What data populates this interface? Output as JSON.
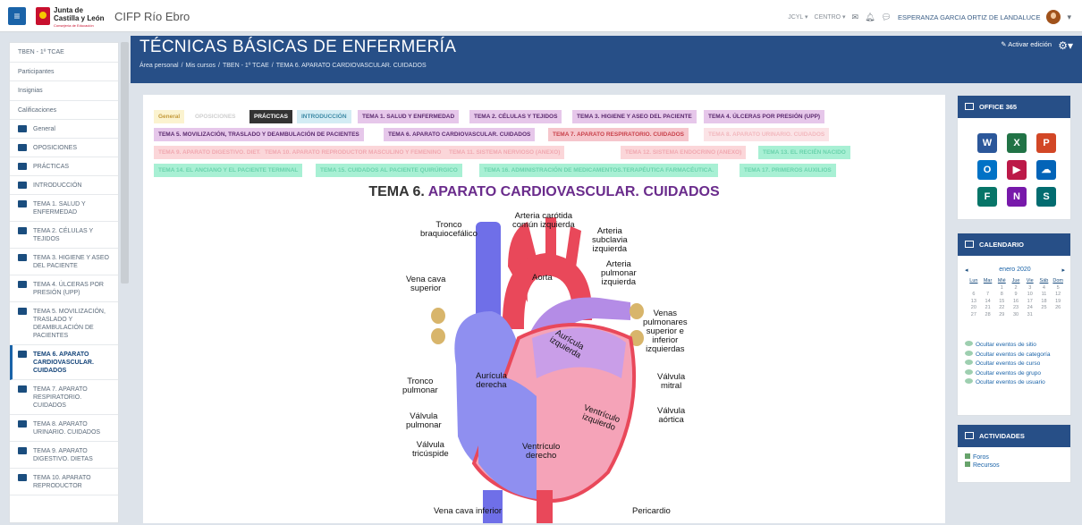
{
  "topbar": {
    "logo_line1": "Junta de",
    "logo_line2": "Castilla y León",
    "logo_line3": "Consejería de Educación",
    "site_name": "CIFP Río Ebro",
    "lang_menu": "JCYL ▾",
    "centro_menu": "CENTRO ▾",
    "user_name": "ESPERANZA GARCIA ORTIZ DE LANDALUCE"
  },
  "sidebar": {
    "links": [
      "TBEN - 1º TCAE",
      "Participantes",
      "Insignias",
      "Calificaciones"
    ],
    "sections": [
      {
        "label": "General"
      },
      {
        "label": "OPOSICIONES"
      },
      {
        "label": "PRÁCTICAS"
      },
      {
        "label": "INTRODUCCIÓN"
      },
      {
        "label": "TEMA 1. SALUD Y ENFERMEDAD"
      },
      {
        "label": "TEMA 2. CÉLULAS Y TEJIDOS"
      },
      {
        "label": "TEMA 3. HIGIENE Y ASEO DEL PACIENTE"
      },
      {
        "label": "TEMA 4. ÚLCERAS POR PRESIÓN (UPP)"
      },
      {
        "label": "TEMA 5. MOVILIZACIÓN, TRASLADO Y DEAMBULACIÓN DE PACIENTES"
      },
      {
        "label": "TEMA 6. APARATO CARDIOVASCULAR. CUIDADOS"
      },
      {
        "label": "TEMA 7. APARATO RESPIRATORIO. CUIDADOS"
      },
      {
        "label": "TEMA 8. APARATO URINARIO. CUIDADOS"
      },
      {
        "label": "TEMA 9. APARATO DIGESTIVO. DIETAS"
      },
      {
        "label": "TEMA 10. APARATO REPRODUCTOR"
      }
    ]
  },
  "header": {
    "course_title": "TÉCNICAS BÁSICAS DE ENFERMERÍA",
    "breadcrumb": [
      "Área personal",
      "/",
      "Mis cursos",
      "/",
      "TBEN - 1º TCAE",
      "/",
      "TEMA 6. APARATO CARDIOVASCULAR. CUIDADOS"
    ],
    "edit_label": "Activar edición"
  },
  "tabs": [
    {
      "label": "General",
      "bg": "#fbf3cf",
      "fg": "#c49a3b"
    },
    {
      "label": "OPOSICIONES",
      "bg": "#ffffff",
      "fg": "#cfcfcf"
    },
    {
      "label": "PRÁCTICAS",
      "bg": "#333333",
      "fg": "#ffffff"
    },
    {
      "label": "INTRODUCCIÓN",
      "bg": "#d3ecf4",
      "fg": "#3d8aa6"
    },
    {
      "label": "TEMA 1. SALUD Y ENFERMEDAD",
      "bg": "#e6c7ea",
      "fg": "#5b2a6e"
    },
    {
      "label": "TEMA 2. CÉLULAS Y TEJIDOS",
      "bg": "#e6c7ea",
      "fg": "#5b2a6e"
    },
    {
      "label": "TEMA 3. HIGIENE Y ASEO DEL PACIENTE",
      "bg": "#e6c7ea",
      "fg": "#5b2a6e"
    },
    {
      "label": "TEMA 4. ÚLCERAS POR PRESIÓN (UPP)",
      "bg": "#e6c7ea",
      "fg": "#5b2a6e"
    },
    {
      "label": "TEMA 5. MOVILIZACIÓN, TRASLADO Y DEAMBULACIÓN DE PACIENTES",
      "bg": "#e6c7ea",
      "fg": "#5b2a6e"
    },
    {
      "label": "TEMA 6. APARATO CARDIOVASCULAR. CUIDADOS",
      "bg": "#e6c7ea",
      "fg": "#5b2a6e"
    },
    {
      "label": "TEMA 7. APARATO RESPIRATORIO. CUIDADOS",
      "bg": "#f6c6cc",
      "fg": "#c9414b"
    },
    {
      "label": "TEMA 8. APARATO URINARIO. CUIDADOS",
      "bg": "#fbe3e6",
      "fg": "#f2b8be"
    },
    {
      "label": "TEMA 9. APARATO DIGESTIVO. DIETAS",
      "bg": "#fbd6d9",
      "fg": "#f0a9b1"
    },
    {
      "label": "TEMA 10. APARATO REPRODUCTOR MASCULINO Y FEMENINO",
      "bg": "#fbd6d9",
      "fg": "#f0a9b1"
    },
    {
      "label": "TEMA 11. SISTEMA NERVIOSO (ANEXO)",
      "bg": "#fbd6d9",
      "fg": "#f0a9b1"
    },
    {
      "label": "TEMA 12. SISTEMA ENDOCRINO (ANEXO)",
      "bg": "#fbd6d9",
      "fg": "#f0a9b1"
    },
    {
      "label": "TEMA 13. EL RECIÉN NACIDO",
      "bg": "#a8f0d4",
      "fg": "#6bd3ad"
    },
    {
      "label": "TEMA 14. EL ANCIANO Y EL PACIENTE TERMINAL",
      "bg": "#a8f0d4",
      "fg": "#6bd3ad"
    },
    {
      "label": "TEMA 15. CUIDADOS AL PACIENTE QUIRÚRGICO",
      "bg": "#a8f0d4",
      "fg": "#6bd3ad"
    },
    {
      "label": "TEMA 16. ADMINISTRACIÓN DE MEDICAMENTOS.TERAPÉUTICA FARMACÉUTICA.",
      "bg": "#a8f0d4",
      "fg": "#6bd3ad"
    },
    {
      "label": "TEMA 17. PRIMEROS AUXILIOS",
      "bg": "#a8f0d4",
      "fg": "#6bd3ad"
    }
  ],
  "content": {
    "title_prefix": "TEMA 6.",
    "title_highlight": "APARATO CARDIOVASCULAR. CUIDADOS"
  },
  "heart_labels": {
    "tronco_braq": "Tronco\nbraquiocefálico",
    "carotida": "Arteria carótida\ncomún izquierda",
    "subclavia": "Arteria\nsubclavia\nizquierda",
    "pulm_art": "Arteria\npulmonar\nizquierda",
    "vena_cava_sup": "Vena cava\nsuperior",
    "aorta": "Aorta",
    "venas_pulm": "Venas\npulmonares\nsuperior e\ninferior\nizquierdas",
    "auricula_izq": "Aurícula\nizquierda",
    "tronco_pulm": "Tronco\npulmonar",
    "auricula_der": "Aurícula\nderecha",
    "valv_mitral": "Válvula\nmitral",
    "valv_aortica": "Válvula\naórtica",
    "ventriculo_izq": "Ventrículo\nizquierdo",
    "valv_pulmonar": "Válvula\npulmonar",
    "valv_tricuspide": "Válvula\ntricúspide",
    "ventriculo_der": "Ventrículo\nderecho",
    "vena_cava_inf": "Vena cava inferior",
    "pericardio": "Pericardio"
  },
  "blocks": {
    "office_title": "OFFICE 365",
    "apps": [
      {
        "letter": "W",
        "color": "#2b579a"
      },
      {
        "letter": "X",
        "color": "#217346"
      },
      {
        "letter": "P",
        "color": "#d24726"
      },
      {
        "letter": "O",
        "color": "#0072c6"
      },
      {
        "letter": "▶",
        "color": "#bc1948"
      },
      {
        "letter": "☁",
        "color": "#0364b8"
      },
      {
        "letter": "F",
        "color": "#077568"
      },
      {
        "letter": "N",
        "color": "#7719aa"
      },
      {
        "letter": "S",
        "color": "#036c70"
      }
    ],
    "calendar_title": "CALENDARIO",
    "calendar_month": "enero 2020",
    "calendar_days": [
      "Lun",
      "Mar",
      "Mié",
      "Jue",
      "Vie",
      "Sáb",
      "Dom"
    ],
    "calendar_weeks": [
      [
        "",
        "",
        "1",
        "2",
        "3",
        "4",
        "5"
      ],
      [
        "6",
        "7",
        "8",
        "9",
        "10",
        "11",
        "12"
      ],
      [
        "13",
        "14",
        "15",
        "16",
        "17",
        "18",
        "19"
      ],
      [
        "20",
        "21",
        "22",
        "23",
        "24",
        "25",
        "26"
      ],
      [
        "27",
        "28",
        "29",
        "30",
        "31",
        "",
        ""
      ]
    ],
    "calendar_filters": [
      "Ocultar eventos de sitio",
      "Ocultar eventos de categoría",
      "Ocultar eventos de curso",
      "Ocultar eventos de grupo",
      "Ocultar eventos de usuario"
    ],
    "activities_title": "ACTIVIDADES",
    "activities": [
      "Foros",
      "Recursos"
    ]
  }
}
